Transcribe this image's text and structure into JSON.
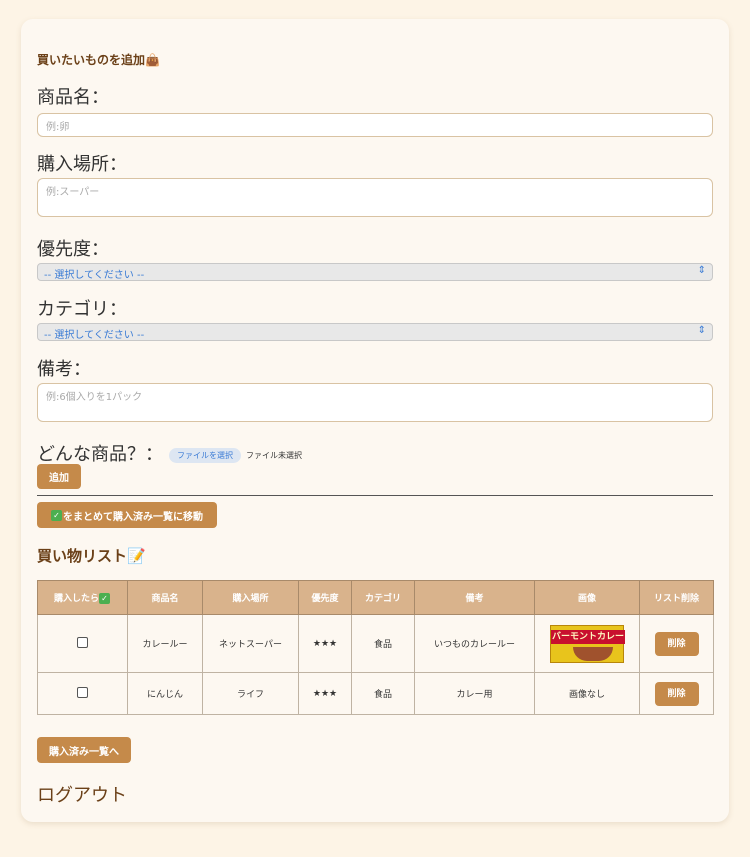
{
  "form": {
    "heading": "買いたいものを追加👜",
    "name_label": "商品名：",
    "name_placeholder": "例:卵",
    "place_label": "購入場所：",
    "place_placeholder": "例:スーパー",
    "priority_label": "優先度：",
    "priority_value": "-- 選択してください --",
    "category_label": "カテゴリ：",
    "category_value": "-- 選択してください --",
    "note_label": "備考：",
    "note_placeholder": "例:6個入りを1パック",
    "image_label": "どんな商品？：",
    "file_button": "ファイルを選択",
    "file_status": "ファイル未選択",
    "add_button": "追加"
  },
  "move_button": "をまとめて購入済み一覧に移動",
  "list_heading": "買い物リスト📝",
  "table": {
    "headers": [
      "購入したら",
      "商品名",
      "購入場所",
      "優先度",
      "カテゴリ",
      "備考",
      "画像",
      "リスト削除"
    ],
    "rows": [
      {
        "name": "カレールー",
        "place": "ネットスーパー",
        "priority": "★★★",
        "category": "食品",
        "note": "いつものカレールー",
        "image": "バーモントカレー",
        "delete": "削除"
      },
      {
        "name": "にんじん",
        "place": "ライフ",
        "priority": "★★★",
        "category": "食品",
        "note": "カレー用",
        "image": "画像なし",
        "delete": "削除"
      }
    ]
  },
  "purchased_button": "購入済み一覧へ",
  "logout": "ログアウト"
}
